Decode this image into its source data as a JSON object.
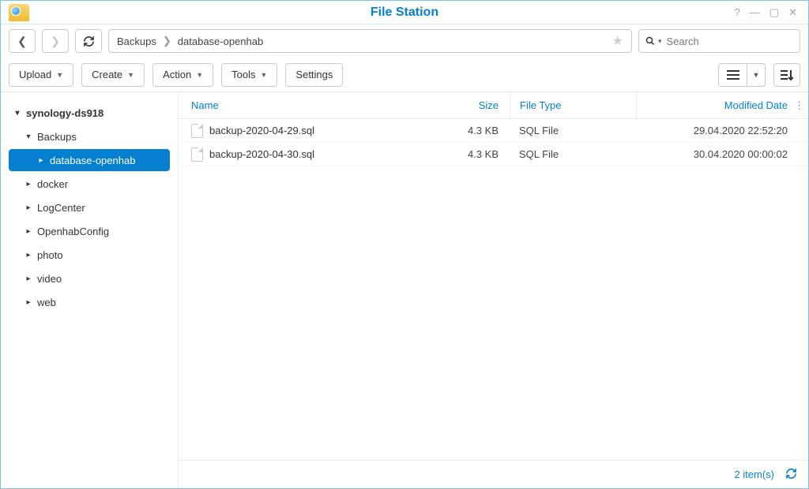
{
  "window": {
    "title": "File Station"
  },
  "breadcrumb": {
    "parts": [
      "Backups",
      "database-openhab"
    ]
  },
  "search": {
    "placeholder": "Search"
  },
  "toolbar": {
    "upload": "Upload",
    "create": "Create",
    "action": "Action",
    "tools": "Tools",
    "settings": "Settings"
  },
  "tree": {
    "root": "synology-ds918",
    "items": [
      {
        "label": "Backups",
        "expanded": true,
        "children": [
          {
            "label": "database-openhab",
            "selected": true
          }
        ]
      },
      {
        "label": "docker"
      },
      {
        "label": "LogCenter"
      },
      {
        "label": "OpenhabConfig"
      },
      {
        "label": "photo"
      },
      {
        "label": "video"
      },
      {
        "label": "web"
      }
    ]
  },
  "columns": {
    "name": "Name",
    "size": "Size",
    "type": "File Type",
    "modified": "Modified Date"
  },
  "files": [
    {
      "name": "backup-2020-04-29.sql",
      "size": "4.3 KB",
      "type": "SQL File",
      "modified": "29.04.2020 22:52:20"
    },
    {
      "name": "backup-2020-04-30.sql",
      "size": "4.3 KB",
      "type": "SQL File",
      "modified": "30.04.2020 00:00:02"
    }
  ],
  "status": {
    "item_count": "2 item(s)"
  }
}
